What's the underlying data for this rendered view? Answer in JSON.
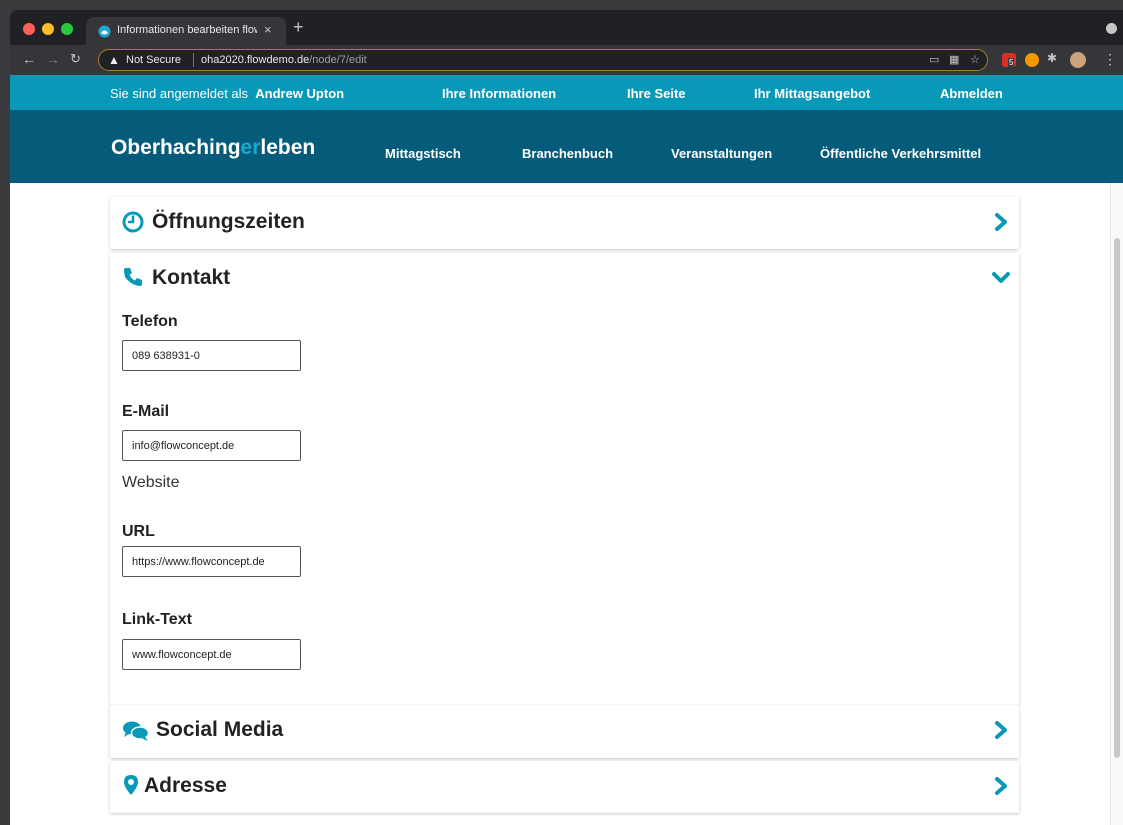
{
  "browser": {
    "tab_title": "Informationen bearbeiten flowc",
    "tab_close": "×",
    "new_tab": "+",
    "not_secure": "Not Secure",
    "url_host": "oha2020.flowdemo.de",
    "url_path": "/node/7/edit",
    "ext_badge": "5",
    "colors": {
      "close": "#ff5f57",
      "minimize": "#febc2e",
      "maximize": "#28c840"
    }
  },
  "topbar": {
    "logged_in_prefix": "Sie sind angemeldet als",
    "user_name": "Andrew Upton",
    "links": [
      "Ihre Informationen",
      "Ihre Seite",
      "Ihr Mittagsangebot",
      "Abmelden"
    ]
  },
  "header": {
    "logo_part1": "Oberhaching",
    "logo_part2": "er",
    "logo_part3": "leben",
    "nav": [
      "Mittagstisch",
      "Branchenbuch",
      "Veranstaltungen",
      "Öffentliche Verkehrsmittel"
    ]
  },
  "sections": {
    "oeffnungszeiten": {
      "title": "Öffnungszeiten",
      "icon": "clock-icon",
      "state": "collapsed"
    },
    "kontakt": {
      "title": "Kontakt",
      "icon": "phone-icon",
      "state": "expanded",
      "telefon_label": "Telefon",
      "telefon_value": "089 638931-0",
      "email_label": "E-Mail",
      "email_value": "info@flowconcept.de",
      "website_label": "Website",
      "url_label": "URL",
      "url_value": "https://www.flowconcept.de",
      "linktext_label": "Link-Text",
      "linktext_value": "www.flowconcept.de"
    },
    "social_media": {
      "title": "Social Media",
      "icon": "comments-icon",
      "state": "collapsed"
    },
    "adresse": {
      "title": "Adresse",
      "icon": "map-marker-icon",
      "state": "collapsed"
    }
  },
  "colors": {
    "accent": "#0899b8",
    "header_bg": "#055c7a",
    "logo_accent": "#1ea7cc"
  }
}
